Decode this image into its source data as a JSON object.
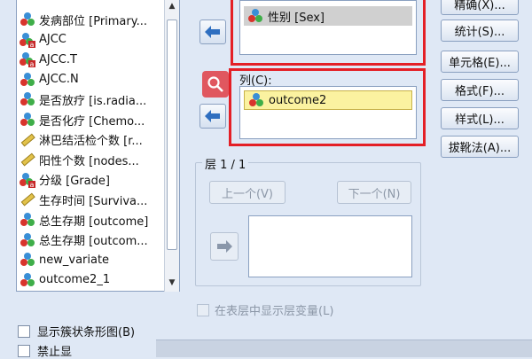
{
  "variables": [
    {
      "label": "发病部位 [Primary...",
      "icon": "nominal-icon"
    },
    {
      "label": "AJCC",
      "icon": "nominal-string-icon"
    },
    {
      "label": "AJCC.T",
      "icon": "nominal-string-icon"
    },
    {
      "label": "AJCC.N",
      "icon": "nominal-icon"
    },
    {
      "label": "是否放疗 [is.radia...",
      "icon": "nominal-icon"
    },
    {
      "label": "是否化疗 [Chemo...",
      "icon": "nominal-icon"
    },
    {
      "label": "淋巴结活检个数 [r...",
      "icon": "scale-icon"
    },
    {
      "label": "阳性个数 [nodes...",
      "icon": "scale-icon"
    },
    {
      "label": "分级 [Grade]",
      "icon": "nominal-string-icon"
    },
    {
      "label": "生存时间 [Surviva...",
      "icon": "scale-icon"
    },
    {
      "label": "总生存期 [outcome]",
      "icon": "nominal-icon"
    },
    {
      "label": "总生存期 [outcom...",
      "icon": "nominal-icon"
    },
    {
      "label": "new_variate",
      "icon": "nominal-icon"
    },
    {
      "label": "outcome2_1",
      "icon": "nominal-icon"
    }
  ],
  "rows_box": {
    "selected": "性别 [Sex]"
  },
  "columns_box": {
    "label": "列(C):",
    "selected": "outcome2"
  },
  "layer": {
    "title": "层 1 / 1",
    "prev_button": "上一个(V)",
    "next_button": "下一个(N)",
    "show_layer_checkbox": "在表层中显示层变量(L)"
  },
  "side_buttons": [
    "精确(X)...",
    "统计(S)...",
    "单元格(E)...",
    "格式(F)...",
    "样式(L)...",
    "拔靴法(A)..."
  ],
  "bottom": {
    "bar_chart_checkbox": "显示簇状条形图(B)",
    "suppress_checkbox": "禁止显"
  },
  "colors": {
    "highlight_frame": "#e41f26",
    "selected_item": "#fbf2a0",
    "zoom_button": "#e0575f"
  }
}
